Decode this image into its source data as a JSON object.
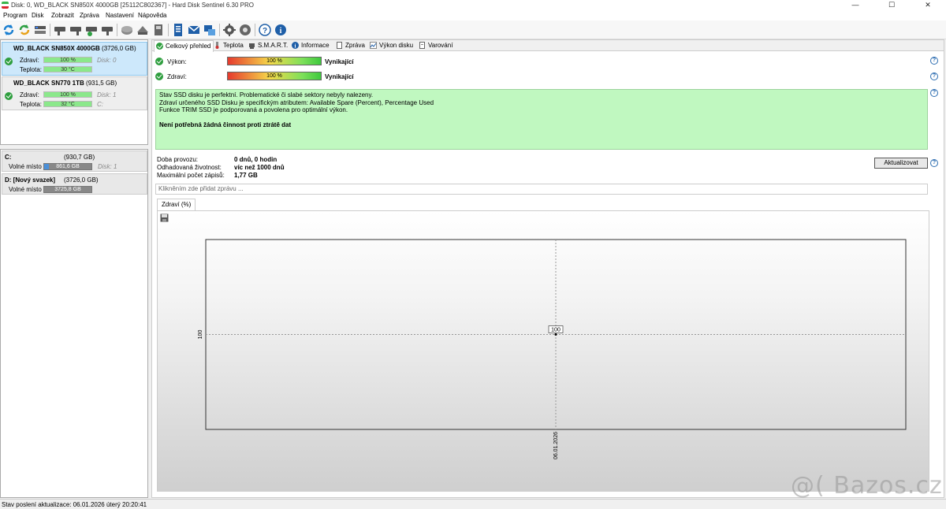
{
  "window": {
    "title": "Disk: 0, WD_BLACK SN850X 4000GB [25112C802367]  -  Hard Disk Sentinel 6.30 PRO",
    "minimize": "—",
    "maximize": "☐",
    "close": "✕"
  },
  "menu": {
    "items": [
      "Program",
      "Disk",
      "Zobrazit",
      "Zpráva",
      "Nastavení",
      "Nápověda"
    ]
  },
  "toolbar": {
    "icons": [
      "refresh-icon",
      "refresh-all-icon",
      "disk-list-icon",
      "surface-test-icon",
      "disk-test-icon",
      "disk-ok-icon",
      "disk-check-icon",
      "acoustic-icon",
      "spindown-icon",
      "backup-icon",
      "report-icon",
      "email-icon",
      "send-icon",
      "settings-icon",
      "alerts-icon",
      "help-icon",
      "info-icon"
    ]
  },
  "disks": [
    {
      "name": "WD_BLACK SN850X 4000GB",
      "size": "(3726,0 GB)",
      "health_label": "Zdraví:",
      "health": "100 %",
      "health_fraction": 1.0,
      "temp_label": "Teplota:",
      "temp": "30 °C",
      "disk_note": "Disk: 0",
      "vol_note": ""
    },
    {
      "name": "WD_BLACK SN770 1TB",
      "size": "(931,5 GB)",
      "health_label": "Zdraví:",
      "health": "100 %",
      "health_fraction": 1.0,
      "temp_label": "Teplota:",
      "temp": "32 °C",
      "disk_note": "Disk: 1",
      "vol_note": "C:"
    }
  ],
  "volumes": [
    {
      "name": "C:",
      "size": "(930,7 GB)",
      "free_label": "Volné místo",
      "free": "861,6 GB",
      "free_fraction": 0.93,
      "note": "Disk: 1"
    },
    {
      "name": "D: [Nový svazek]",
      "size": "(3726,0 GB)",
      "free_label": "Volné místo",
      "free": "3725,8 GB",
      "free_fraction": 1.0,
      "note": ""
    }
  ],
  "tabs": [
    "Celkový přehled",
    "Teplota",
    "S.M.A.R.T.",
    "Informace",
    "Zpráva",
    "Výkon disku",
    "Varování"
  ],
  "overview": {
    "performance_label": "Výkon:",
    "performance": "100 %",
    "performance_rating": "Vynikající",
    "health_label": "Zdraví:",
    "health": "100 %",
    "health_rating": "Vynikající",
    "status_lines": [
      "Stav SSD disku je perfektní. Problematické či slabé sektory nebyly nalezeny.",
      "Zdraví určeného SSD Disku je specifickým atributem:  Available Spare (Percent), Percentage Used",
      "Funkce TRIM SSD je podporovaná a povolena pro optimální výkon."
    ],
    "status_bold": "Není potřebná žádná činnost proti ztrátě dat",
    "uptime_label": "Doba provozu:",
    "uptime": "0 dnů, 0 hodin",
    "lifetime_label": "Odhadovaná životnost:",
    "lifetime": "víc než 1000 dnů",
    "writes_label": "Maximální počet zápisů:",
    "writes": "1,77 GB",
    "refresh_button": "Aktualizovat",
    "message_placeholder": "Klikněním zde přidat zprávu ..."
  },
  "chart_tab": "Zdraví (%)",
  "chart_data": {
    "type": "line",
    "x": [
      "06.01.2026"
    ],
    "y": [
      100
    ],
    "ytick": "100",
    "xtick": "06.01.2026",
    "point_label": "100",
    "grid": true
  },
  "statusbar": {
    "text": "Stav poslení aktualizace: 06.01.2026 úterý 20:20:41"
  },
  "watermark": "@( Bazos.cz"
}
